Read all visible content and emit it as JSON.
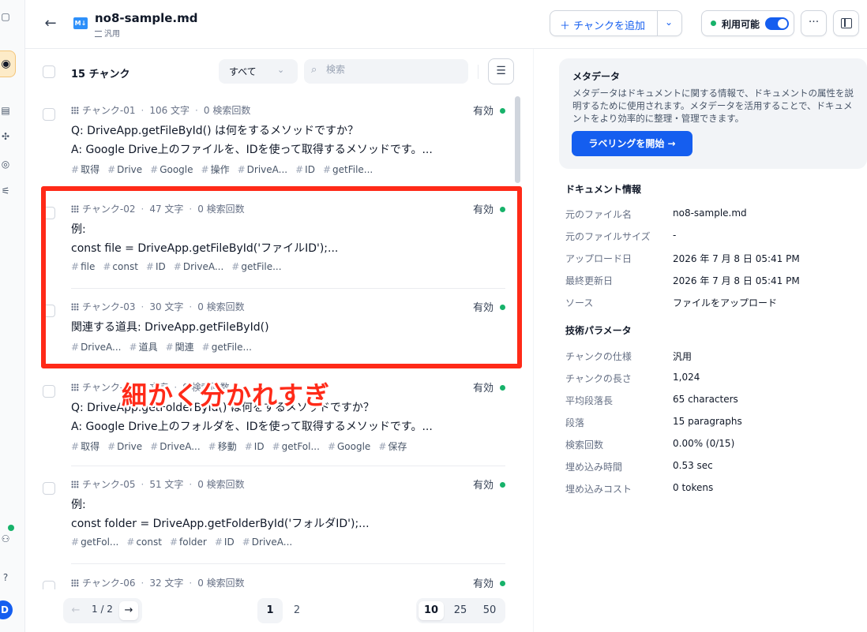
{
  "header": {
    "file_name": "no8-sample.md",
    "file_icon_text": "M↓",
    "file_type": "汎用",
    "add_chunk_label": "チャンクを追加",
    "status_label": "利用可能",
    "more_label": "···"
  },
  "toolbar": {
    "chunk_count": "15 チャンク",
    "filter_value": "すべて",
    "search_placeholder": "検索"
  },
  "chunks": [
    {
      "id": "チャンク-01",
      "chars": "106 文字",
      "retrievals": "0 検索回数",
      "status": "有効",
      "lines": [
        "Q: DriveApp.getFileById() は何をするメソッドですか？",
        "A: Google Drive上のファイルを、IDを使って取得するメソッドです。..."
      ],
      "tags": [
        "取得",
        "Drive",
        "Google",
        "操作",
        "DriveA...",
        "ID",
        "getFile..."
      ]
    },
    {
      "id": "チャンク-02",
      "chars": "47 文字",
      "retrievals": "0 検索回数",
      "status": "有効",
      "lines": [
        "例:",
        "const file = DriveApp.getFileById('ファイルID');..."
      ],
      "tags": [
        "file",
        "const",
        "ID",
        "DriveA...",
        "getFile..."
      ]
    },
    {
      "id": "チャンク-03",
      "chars": "30 文字",
      "retrievals": "0 検索回数",
      "status": "有効",
      "lines": [
        "関連する道具: DriveApp.getFileById()"
      ],
      "tags": [
        "DriveA...",
        "道具",
        "関連",
        "getFile..."
      ]
    },
    {
      "id": "チャンク-04",
      "chars": "文字",
      "retrievals": "0 検索回数",
      "status": "有効",
      "lines": [
        "Q: DriveApp.getFolderById() は何をするメソッドですか？",
        "A: Google Drive上のフォルダを、IDを使って取得するメソッドです。..."
      ],
      "tags": [
        "取得",
        "Drive",
        "DriveA...",
        "移動",
        "ID",
        "getFol...",
        "Google",
        "保存"
      ]
    },
    {
      "id": "チャンク-05",
      "chars": "51 文字",
      "retrievals": "0 検索回数",
      "status": "有効",
      "lines": [
        "例:",
        "const folder = DriveApp.getFolderById('フォルダID');..."
      ],
      "tags": [
        "getFol...",
        "const",
        "folder",
        "ID",
        "DriveA..."
      ]
    },
    {
      "id": "チャンク-06",
      "chars": "32 文字",
      "retrievals": "0 検索回数",
      "status": "有効",
      "lines": [],
      "tags": []
    }
  ],
  "annotation": "細かく分かれすぎ",
  "pagination": {
    "current": "1 / 2",
    "pages": [
      "1",
      "2"
    ],
    "sizes": [
      "10",
      "25",
      "50"
    ]
  },
  "metadata_card": {
    "title": "メタデータ",
    "description": "メタデータはドキュメントに関する情報で、ドキュメントの属性を説明するために使用されます。メタデータを活用することで、ドキュメントをより効率的に整理・管理できます。",
    "button_label": "ラベリングを開始 →"
  },
  "doc_info": {
    "title": "ドキュメント情報",
    "rows": [
      {
        "key": "元のファイル名",
        "value": "no8-sample.md"
      },
      {
        "key": "元のファイルサイズ",
        "value": "-"
      },
      {
        "key": "アップロード日",
        "value": "2026 年 7 月 8 日 05:41 PM"
      },
      {
        "key": "最終更新日",
        "value": "2026 年 7 月 8 日 05:41 PM"
      },
      {
        "key": "ソース",
        "value": "ファイルをアップロード"
      }
    ]
  },
  "tech_params": {
    "title": "技術パラメータ",
    "rows": [
      {
        "key": "チャンクの仕様",
        "value": "汎用"
      },
      {
        "key": "チャンクの長さ",
        "value": "1,024"
      },
      {
        "key": "平均段落長",
        "value": "65 characters"
      },
      {
        "key": "段落",
        "value": "15 paragraphs"
      },
      {
        "key": "検索回数",
        "value": "0.00% (0/15)"
      },
      {
        "key": "埋め込み時間",
        "value": "0.53 sec"
      },
      {
        "key": "埋め込みコスト",
        "value": "0 tokens"
      }
    ]
  },
  "colors": {
    "accent": "#155eef",
    "status_green": "#17b26a",
    "annotation_red": "#ff2a18"
  }
}
